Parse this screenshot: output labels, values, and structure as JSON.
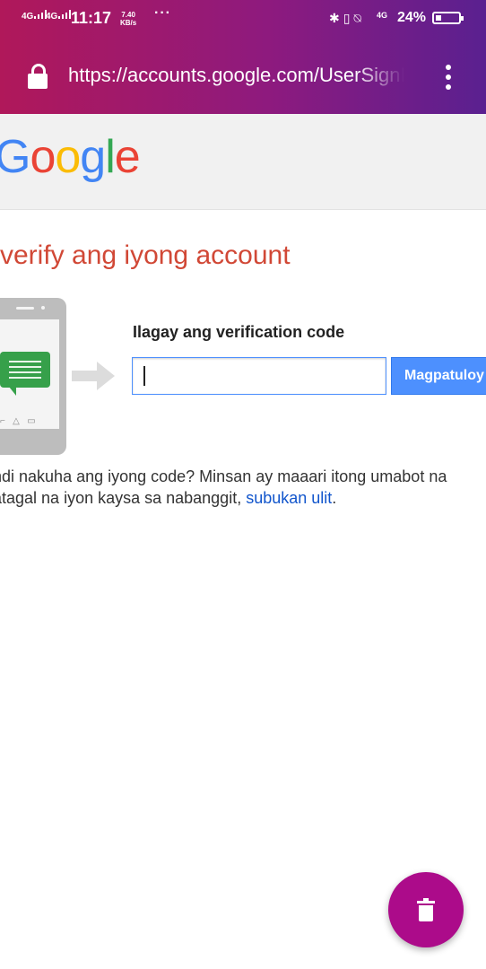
{
  "status_bar": {
    "sim1": "4G",
    "sim2": "4G",
    "time": "11:17",
    "speed_value": "7.40",
    "speed_unit": "KB/s",
    "more": "···",
    "network": "4G",
    "battery": "24%",
    "battery_level": 0.24
  },
  "browser": {
    "url": "https://accounts.google.com/UserSignIn",
    "secure_icon": "lock-icon",
    "menu_icon": "more-vert-icon"
  },
  "google_logo": {
    "letters": [
      "G",
      "o",
      "o",
      "g",
      "l",
      "e"
    ],
    "colors": [
      "#4285f4",
      "#ea4335",
      "#fbbc05",
      "#4285f4",
      "#34a853",
      "#ea4335"
    ]
  },
  "page": {
    "title": "verify ang iyong account",
    "input_label": "Ilagay ang verification code",
    "input_value": "",
    "continue_button": "Magpatuloy",
    "note_line1": "ndi nakuha ang iyong code? Minsan ay maaari itong umabot na",
    "note_line2_prefix": "atagal na iyon kaysa sa nabanggit, ",
    "note_link": "subukan ulit",
    "note_line2_suffix": "."
  },
  "fab": {
    "icon": "trash-icon",
    "color": "#ac0b8a"
  },
  "colors": {
    "title": "#d14836",
    "button": "#4d90fe",
    "link": "#1155cc",
    "sms_bubble": "#36a04a"
  }
}
